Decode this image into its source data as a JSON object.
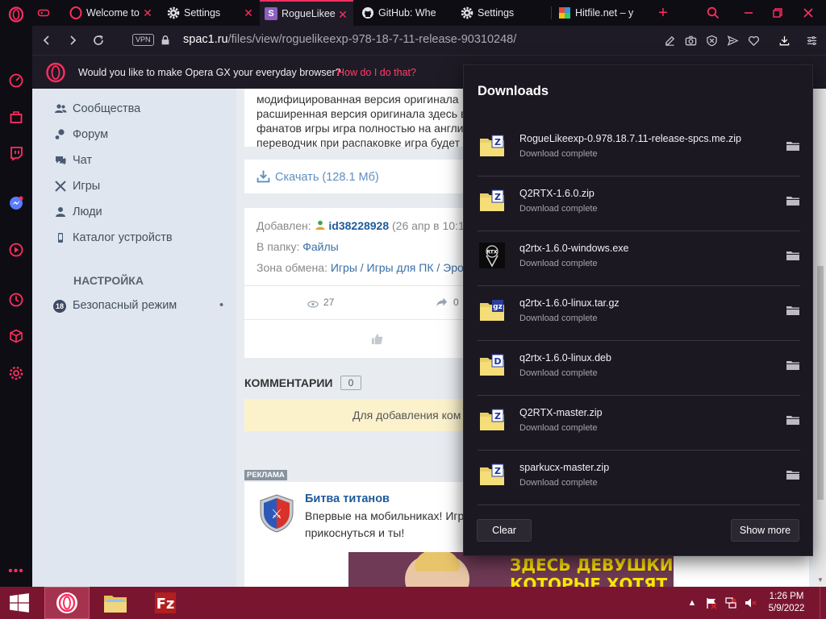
{
  "tabs": [
    {
      "label": "Welcome to",
      "icon": "opera-icon"
    },
    {
      "label": "Settings",
      "icon": "gear-icon"
    },
    {
      "label": "RogueLikee",
      "icon": "s-icon",
      "active": true
    },
    {
      "label": "GitHub: Whe",
      "icon": "github-icon"
    },
    {
      "label": "Settings",
      "icon": "gear-icon"
    },
    {
      "label": "Hitfile.net – y",
      "icon": "hitfile-icon"
    }
  ],
  "address": {
    "vpn": "VPN",
    "host": "spac1.ru",
    "path": "/files/view/roguelikeexp-978-18-7-11-release-90310248/"
  },
  "promo": {
    "text": "Would you like to make Opera GX your everyday browser?",
    "link": "How do I do that?"
  },
  "left_nav": {
    "items": [
      {
        "label": "Сообщества",
        "icon": "people-icon"
      },
      {
        "label": "Форум",
        "icon": "forum-icon"
      },
      {
        "label": "Чат",
        "icon": "chat-icon"
      },
      {
        "label": "Игры",
        "icon": "swords-icon"
      },
      {
        "label": "Люди",
        "icon": "user-icon"
      },
      {
        "label": "Каталог устройств",
        "icon": "phone-icon"
      }
    ],
    "settings_heading": "НАСТРОЙКА",
    "safe_mode": {
      "badge": "18",
      "label": "Безопасный режим",
      "dot": "•"
    }
  },
  "content": {
    "desc_lines": [
      "модифицированная версия оригинала",
      "расширенная версия оригинала здесь в",
      "фанатов игры игра полностью на англи",
      "переводчик при распаковке игра будет"
    ],
    "download_link": "Скачать (128.1 Мб)",
    "added_label": "Добавлен:",
    "added_user": "id38228928",
    "added_date": "(26 апр в 10:1",
    "folder_label": "В папку:",
    "folder_value": "Файлы",
    "zone_label": "Зона обмена:",
    "zone_value": "Игры / Игры для ПК / Эро",
    "views": "27",
    "shares": "0",
    "comments_title": "КОММЕНТАРИИ",
    "comments_count": "0",
    "comment_banner": "Для добавления ком"
  },
  "ad": {
    "tag": "РЕКЛАМА",
    "title": "Битва титанов",
    "text1": "Впервые на мобильниках! Игр",
    "text2": "прикоснуться и ты!",
    "banner_line1": "ЗДЕСЬ ДЕВУШКИ",
    "banner_line2": "КОТОРЫЕ ХОТЯТ"
  },
  "downloads": {
    "title": "Downloads",
    "items": [
      {
        "name": "RogueLikeexp-0.978.18.7.11-release-spcs.me.zip",
        "status": "Download complete",
        "type": "Z"
      },
      {
        "name": "Q2RTX-1.6.0.zip",
        "status": "Download complete",
        "type": "Z"
      },
      {
        "name": "q2rtx-1.6.0-windows.exe",
        "status": "Download complete",
        "type": "exe"
      },
      {
        "name": "q2rtx-1.6.0-linux.tar.gz",
        "status": "Download complete",
        "type": "gz"
      },
      {
        "name": "q2rtx-1.6.0-linux.deb",
        "status": "Download complete",
        "type": "D"
      },
      {
        "name": "Q2RTX-master.zip",
        "status": "Download complete",
        "type": "Z"
      },
      {
        "name": "sparkucx-master.zip",
        "status": "Download complete",
        "type": "Z"
      }
    ],
    "clear_label": "Clear",
    "show_more_label": "Show more"
  },
  "taskbar": {
    "time": "1:26 PM",
    "date": "5/9/2022"
  },
  "colors": {
    "accent": "#ff2e5f",
    "browser_bg": "#0f0d14",
    "panel_bg": "#1b1822",
    "taskbar": "#7a1530"
  }
}
